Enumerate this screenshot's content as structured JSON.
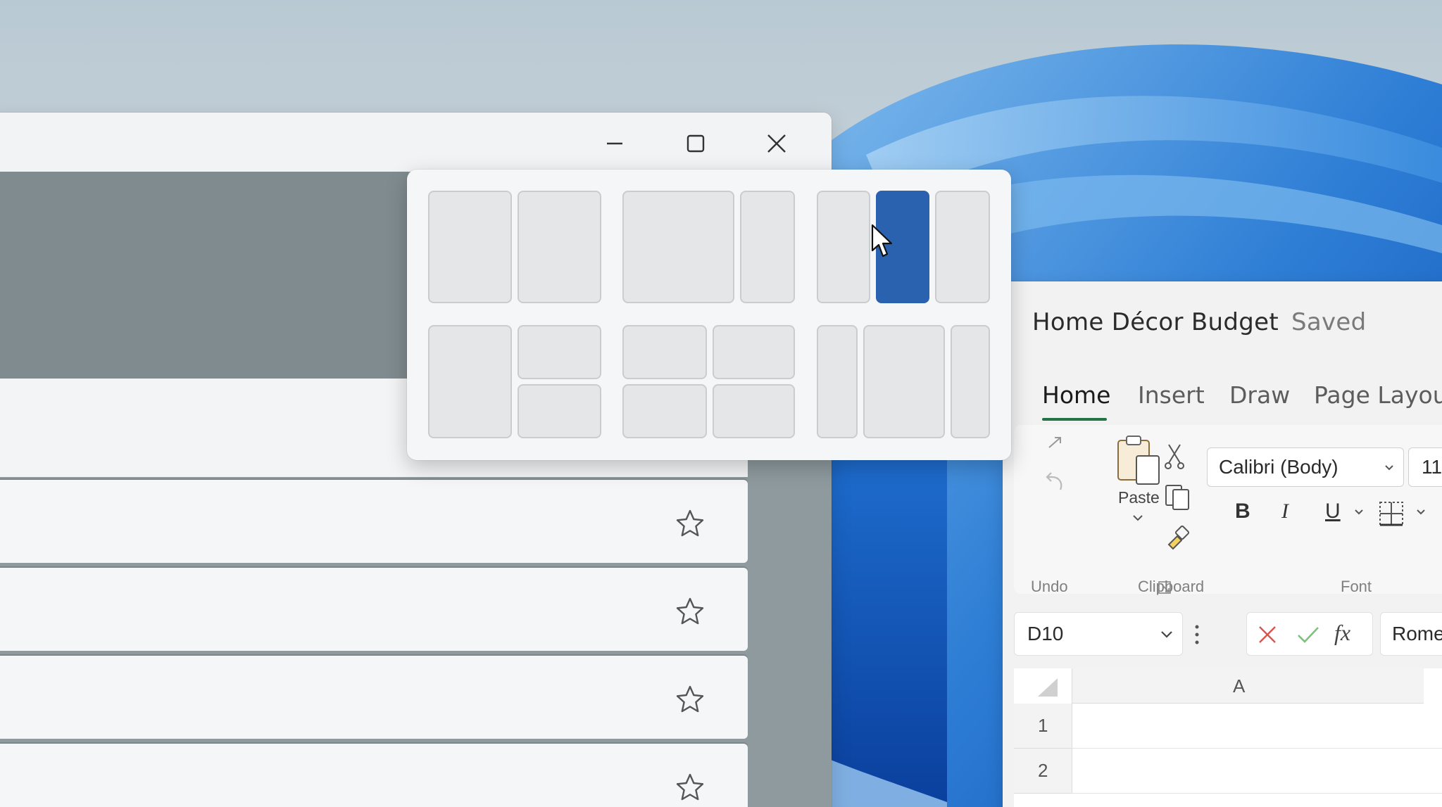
{
  "left_window": {
    "caption_buttons": [
      "minimize",
      "maximize",
      "close"
    ],
    "list_rows": 4
  },
  "snap_layouts": {
    "layouts": [
      {
        "name": "two-equal-columns",
        "zones": 2
      },
      {
        "name": "wide-left-narrow-right",
        "zones": 2
      },
      {
        "name": "three-columns",
        "zones": 3,
        "active_zone": 2
      },
      {
        "name": "left-column-two-stacked-right",
        "zones": 3
      },
      {
        "name": "four-quadrants",
        "zones": 4
      },
      {
        "name": "narrow-wide-narrow",
        "zones": 3
      }
    ],
    "accent_color": "#2a62b0"
  },
  "excel": {
    "title": "Home Décor Budget",
    "status": "Saved",
    "tabs": [
      "Home",
      "Insert",
      "Draw",
      "Page Layout"
    ],
    "active_tab": "Home",
    "ribbon": {
      "paste_label": "Paste",
      "undo_label": "Undo",
      "clipboard_label": "Clipboard",
      "font_label": "Font",
      "font_name": "Calibri (Body)",
      "font_size": "11",
      "bold": "B",
      "italic": "I",
      "underline": "U"
    },
    "formula_bar": {
      "name_box": "D10",
      "fx": "fx",
      "value": "Rome"
    },
    "grid": {
      "column_header": "A",
      "row_numbers": [
        "1",
        "2"
      ]
    },
    "accent_color": "#227447"
  }
}
